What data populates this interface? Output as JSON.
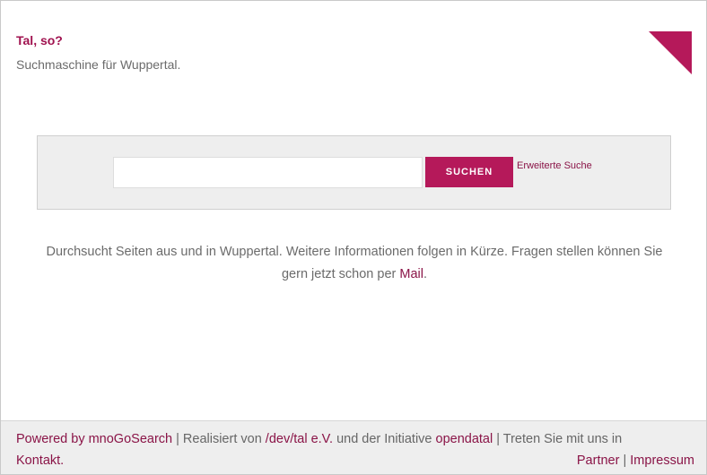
{
  "header": {
    "title": "Tal, so?",
    "tagline": "Suchmaschine für Wuppertal."
  },
  "search": {
    "input_value": "",
    "placeholder": "",
    "button_label": "SUCHEN",
    "advanced_link": "Erweiterte Suche"
  },
  "description": {
    "text_before": "Durchsucht Seiten aus und in Wuppertal. Weitere Informationen folgen in Kürze. Fragen stellen können Sie gern jetzt schon per ",
    "mail_link": "Mail",
    "text_after": "."
  },
  "footer": {
    "powered_by": "Powered by mnoGoSearch",
    "sep1": " | Realisiert von ",
    "devtal": "/dev/tal e.V.",
    "and_text": " und der Initiative ",
    "opendatal": "opendatal",
    "contact_text": " | Treten Sie mit uns in",
    "kontakt": "Kontakt.",
    "partner": "Partner",
    "sep2": " | ",
    "impressum": "Impressum"
  },
  "colors": {
    "accent": "#b5195a",
    "link": "#8a1447",
    "search_bg": "#eeeeee"
  },
  "icons": {
    "corner": "corner-triangle-icon"
  }
}
